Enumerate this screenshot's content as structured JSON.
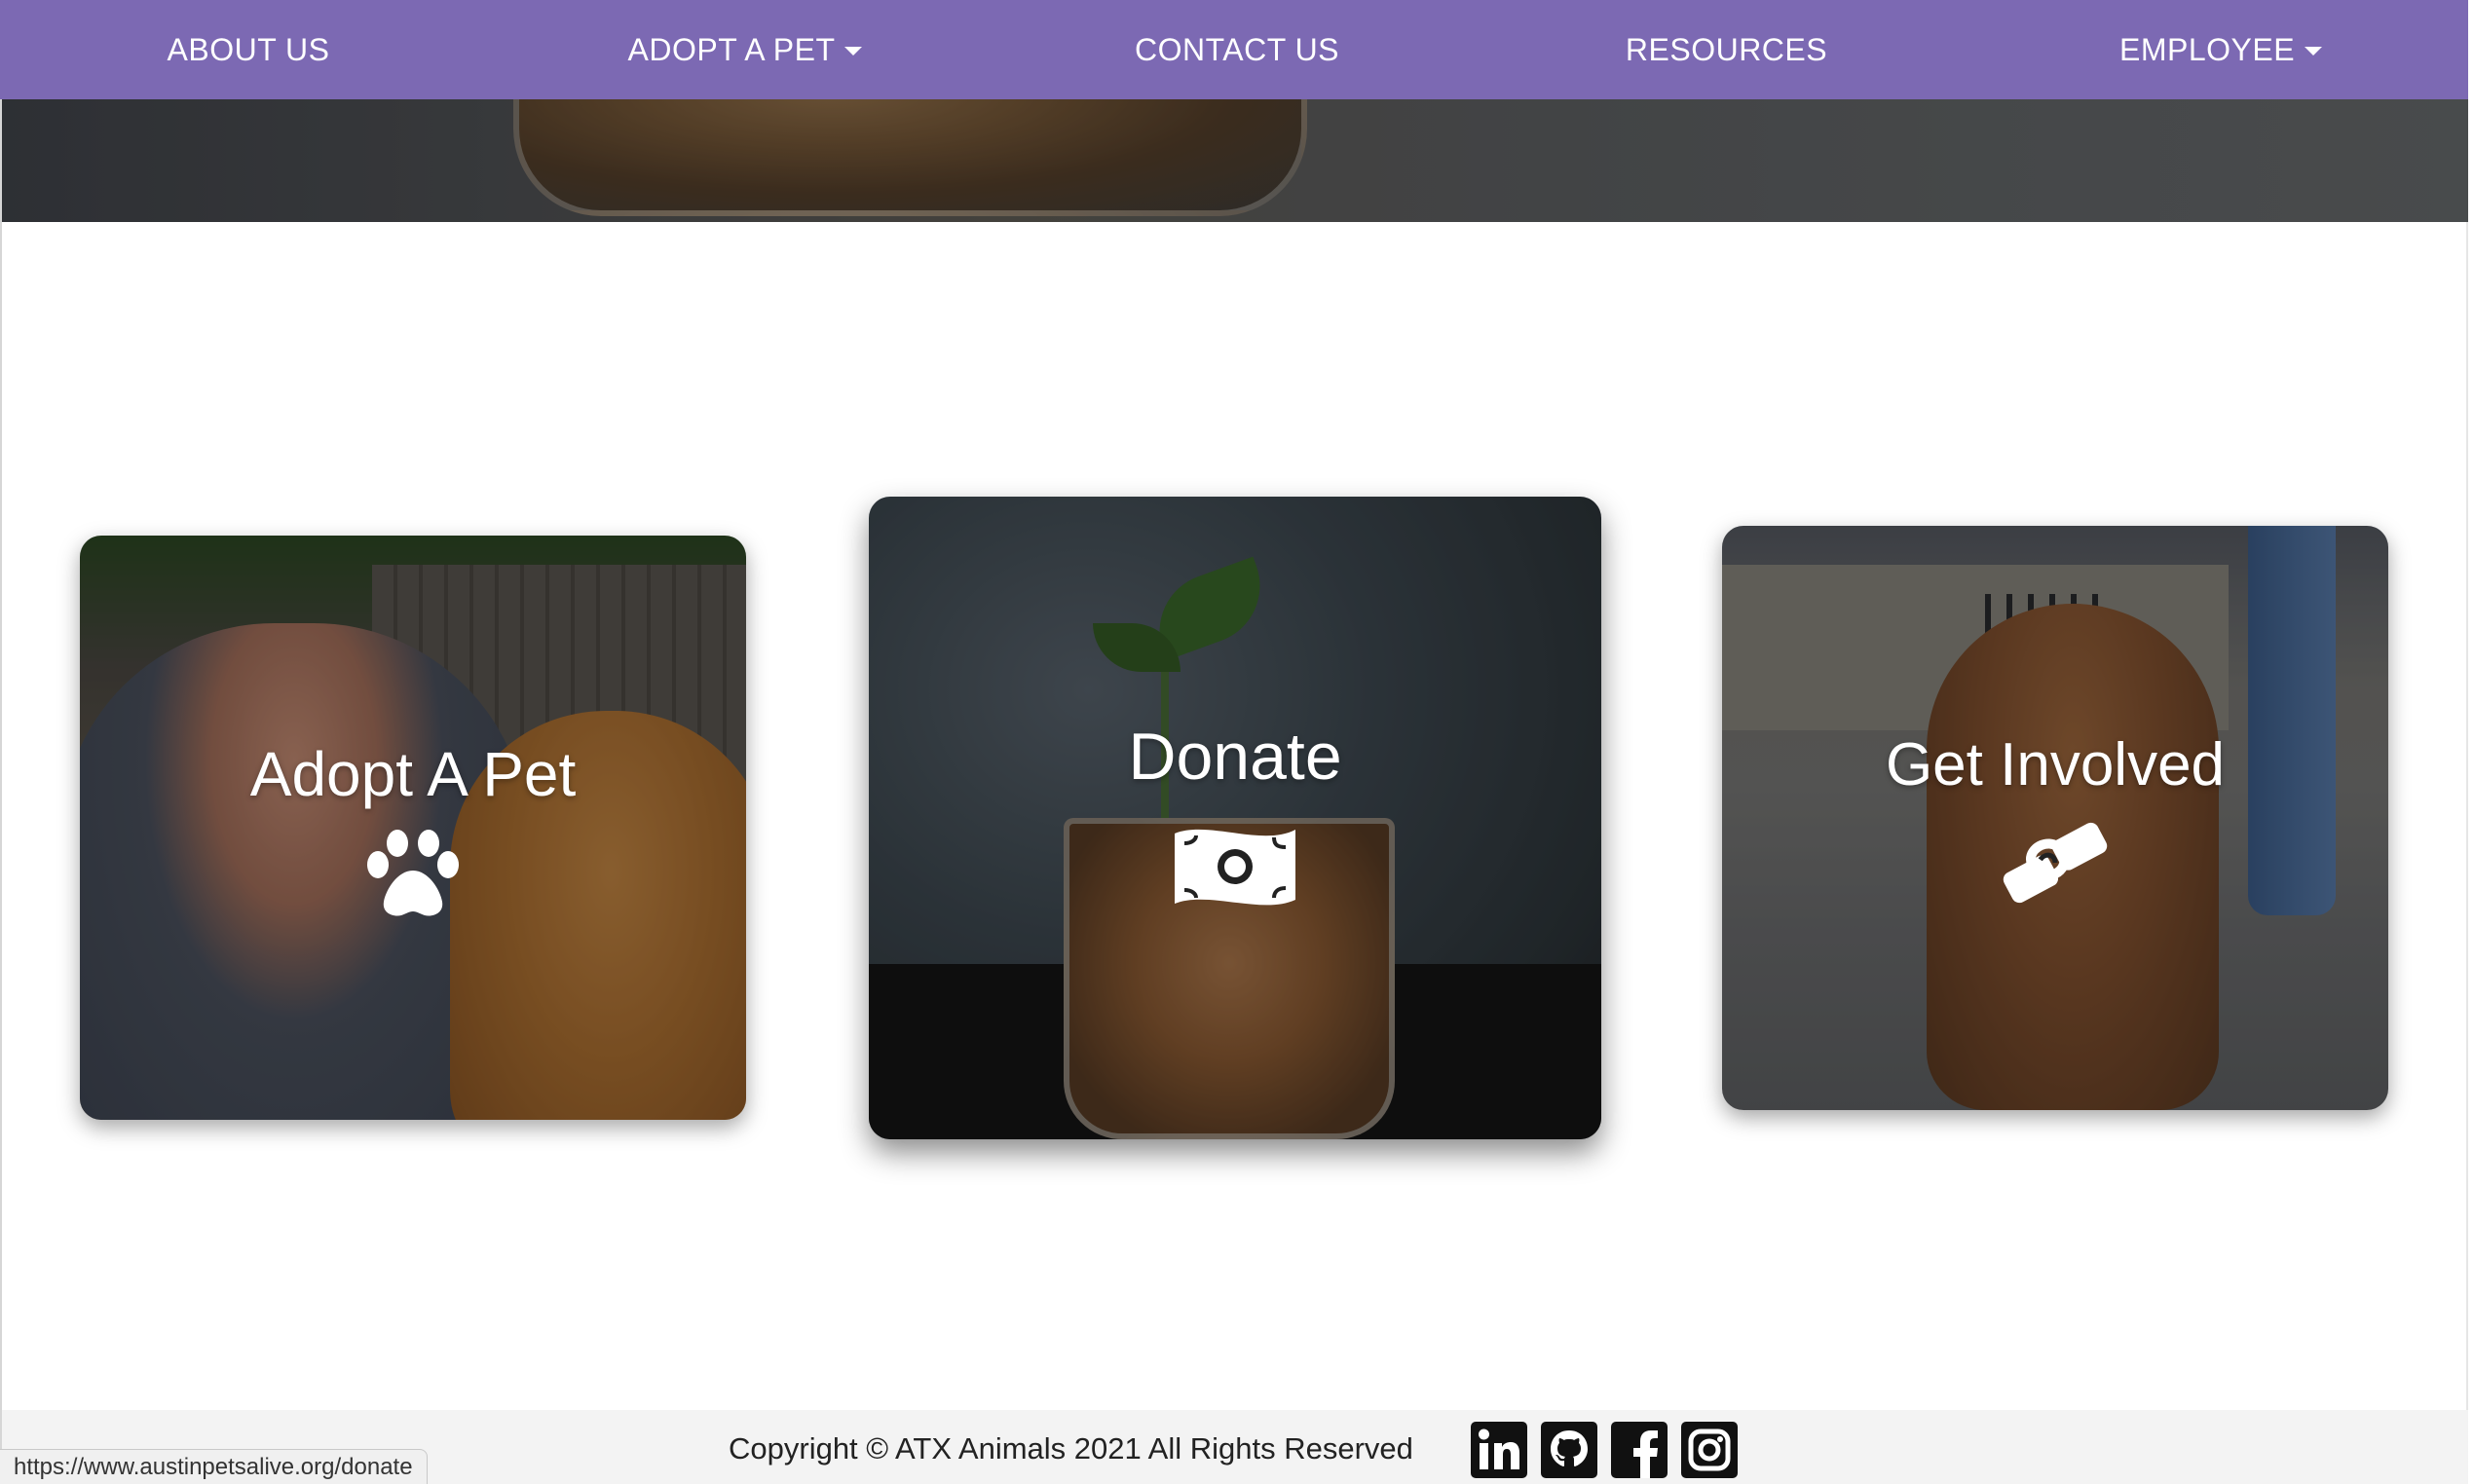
{
  "nav": {
    "about": "ABOUT US",
    "adopt": "ADOPT A PET",
    "contact": "CONTACT US",
    "resources": "RESOURCES",
    "employee": "EMPLOYEE"
  },
  "cards": [
    {
      "title": "Adopt A Pet",
      "icon": "paw-icon"
    },
    {
      "title": "Donate",
      "icon": "money-bill-icon"
    },
    {
      "title": "Get Involved",
      "icon": "handshake-icon"
    }
  ],
  "footer": {
    "copyright": "Copyright © ATX Animals 2021 All Rights Reserved",
    "social": [
      "linkedin-icon",
      "github-icon",
      "facebook-icon",
      "instagram-icon"
    ]
  },
  "status_bar": {
    "url": "https://www.austinpetsalive.org/donate"
  },
  "colors": {
    "nav_bg": "#7c69b3",
    "footer_bg": "#f3f3f3",
    "nav_text": "#ffffff"
  }
}
